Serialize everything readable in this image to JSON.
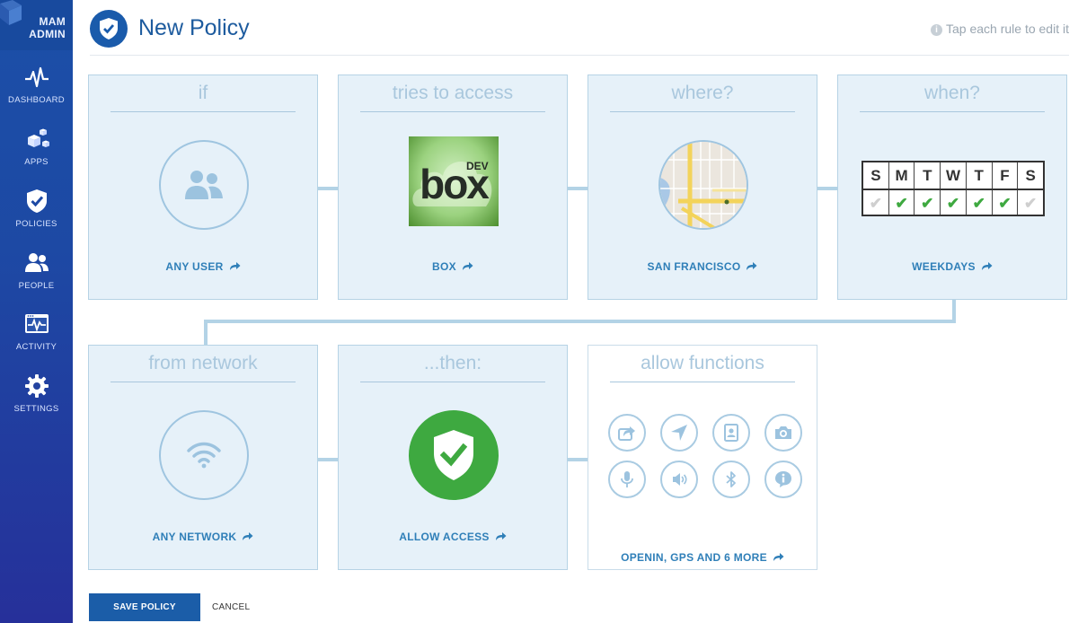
{
  "sidebar": {
    "brand_line1": "MAM",
    "brand_line2": "ADMIN",
    "items": [
      {
        "label": "DASHBOARD",
        "icon": "pulse-icon"
      },
      {
        "label": "APPS",
        "icon": "cubes-icon"
      },
      {
        "label": "POLICIES",
        "icon": "shield-check-icon"
      },
      {
        "label": "PEOPLE",
        "icon": "people-icon"
      },
      {
        "label": "ACTIVITY",
        "icon": "monitor-activity-icon"
      },
      {
        "label": "SETTINGS",
        "icon": "gear-icon"
      }
    ]
  },
  "header": {
    "title": "New Policy",
    "hint": "Tap each rule to edit it"
  },
  "cards": {
    "user": {
      "title": "if",
      "label": "ANY USER"
    },
    "app": {
      "title": "tries to access",
      "label": "BOX",
      "logo_text": "box",
      "logo_badge": "DEV"
    },
    "location": {
      "title": "where?",
      "label": "SAN FRANCISCO"
    },
    "schedule": {
      "title": "when?",
      "label": "WEEKDAYS",
      "days": [
        "S",
        "M",
        "T",
        "W",
        "T",
        "F",
        "S"
      ],
      "enabled": [
        false,
        true,
        true,
        true,
        true,
        true,
        false
      ]
    },
    "network": {
      "title": "from network",
      "label": "ANY NETWORK"
    },
    "action": {
      "title": "...then:",
      "label": "ALLOW ACCESS"
    },
    "functions": {
      "title": "allow functions",
      "label": "OPENIN, GPS AND 6 MORE",
      "icons": [
        "open-in-icon",
        "gps-icon",
        "contacts-icon",
        "camera-icon",
        "microphone-icon",
        "speaker-icon",
        "bluetooth-icon",
        "info-icon"
      ]
    }
  },
  "footer": {
    "save_label": "SAVE POLICY",
    "cancel_label": "CANCEL"
  },
  "colors": {
    "sidebar": "#1d49a4",
    "accent": "#1b5da8",
    "card_bg": "#e6f1f9",
    "allow_green": "#3ea940"
  }
}
